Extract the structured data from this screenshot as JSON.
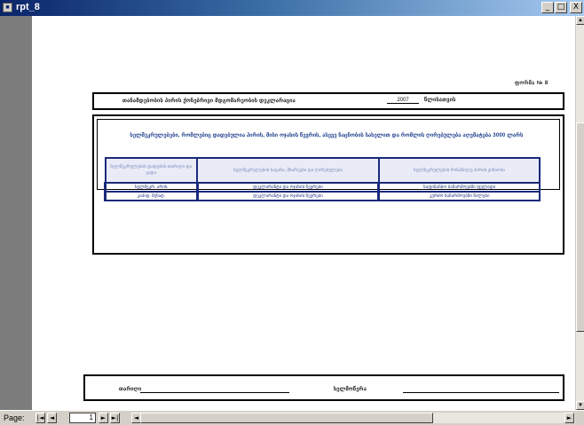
{
  "window": {
    "title": "rpt_8",
    "buttons": {
      "minimize": "_",
      "maximize": "□",
      "close": "X"
    }
  },
  "report": {
    "form_number": "ფორმა № 8",
    "header": {
      "title": "თანამდებობის პირის ქონებრივი მდგომარეობის დეკლარაცია",
      "year": "2007",
      "year_label": "წლისათვის"
    },
    "section_title": "ხელშეკრულებები, რომლებიც დადებულია პირის, მისი ოჯახის წევრის, ასევე ნაცნობის სახელით და რომლის ღირებულება აღემატება 3000 ლარს",
    "table": {
      "headers": [
        "ხელშეკრულების დადების თარიღი და ვადა",
        "ხელშეკრულების საგანი, მხარეები და ღირებულება",
        "ხელშეკრულების მონაწილე პირის ვინაობა"
      ],
      "rows": [
        [
          "ხელშეკრ. არის",
          "დეკლარანტი და ოჯახის წევრები",
          "საფინანსო საწარმოებში ფულადი"
        ],
        [
          "კაპიტ. შენატ.",
          "დეკლარანტი და ოჯახის წევრები",
          "კერძო საწარმოებში წილები"
        ]
      ]
    },
    "footer": {
      "date_label": "თარიღი",
      "signature_label": "ხელმოწერა"
    }
  },
  "statusbar": {
    "page_label": "Page:",
    "page_value": "1",
    "nav": {
      "first": "|◄",
      "prev": "◄",
      "next": "►",
      "last": "►|",
      "hleft": "◄",
      "hright": "►"
    }
  },
  "scrollbar": {
    "up": "▲",
    "down": "▼"
  }
}
